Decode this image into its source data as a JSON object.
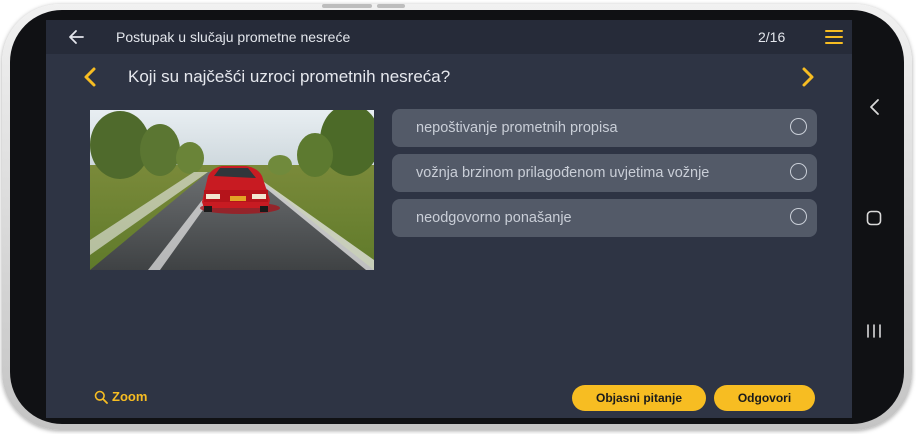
{
  "app": {
    "title": "Postupak u slučaju prometne nesreće",
    "progress": "2/16"
  },
  "question": {
    "text": "Koji su najčešći uzroci prometnih nesreća?",
    "image_icon": "car-crash-photo"
  },
  "answers": [
    {
      "label": "nepoštivanje prometnih propisa",
      "selected": false
    },
    {
      "label": "vožnja brzinom prilagođenom uvjetima vožnje",
      "selected": false
    },
    {
      "label": "neodgovorno ponašanje",
      "selected": false
    }
  ],
  "footer": {
    "zoom_label": "Zoom",
    "explain_label": "Objasni pitanje",
    "answer_label": "Odgovori"
  },
  "colors": {
    "accent": "#f7bd22",
    "background": "#2e3444",
    "appbar": "#262b39",
    "answer_bg": "#535a68"
  },
  "icons": {
    "back": "arrow-left-icon",
    "menu": "hamburger-menu-icon",
    "prev": "chevron-left-icon",
    "next": "chevron-right-icon",
    "zoom": "magnifier-icon"
  }
}
